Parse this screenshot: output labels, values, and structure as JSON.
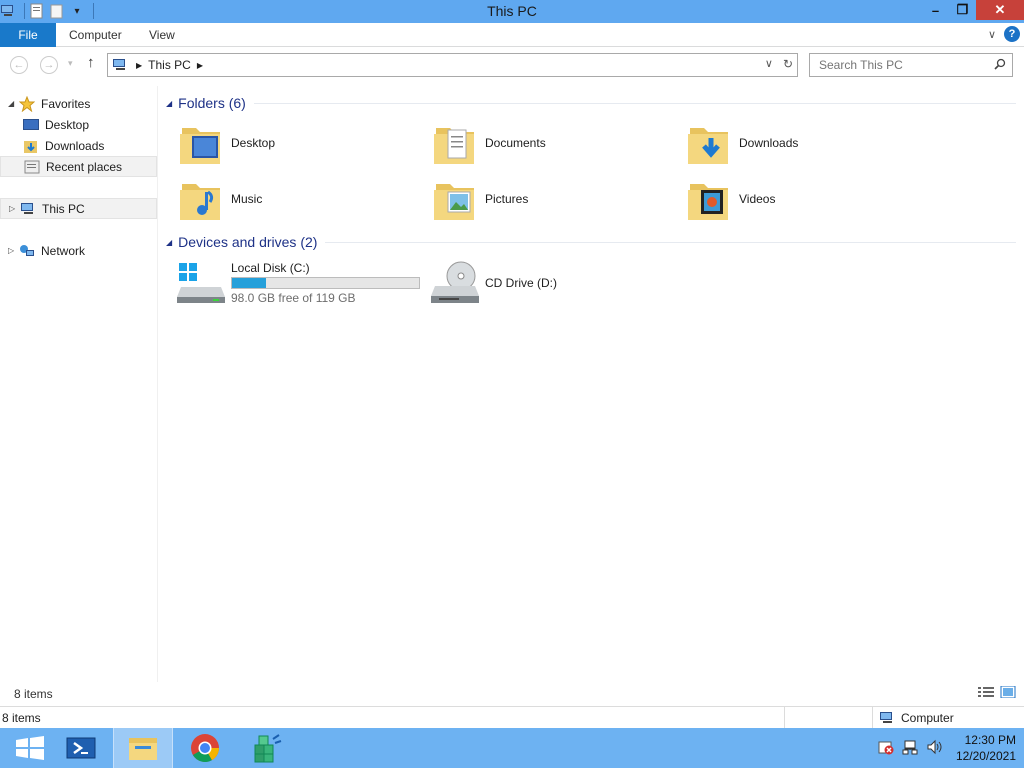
{
  "window": {
    "title": "This PC",
    "buttons": {
      "minimize": "–",
      "restore": "❐",
      "close": "✕"
    }
  },
  "ribbon": {
    "tabs": [
      "File",
      "Computer",
      "View"
    ]
  },
  "address": {
    "path": "This PC",
    "search_placeholder": "Search This PC"
  },
  "nav": {
    "favorites": "Favorites",
    "desktop": "Desktop",
    "downloads": "Downloads",
    "recent": "Recent places",
    "this_pc": "This PC",
    "network": "Network"
  },
  "folders": {
    "header": "Folders (6)",
    "items": [
      "Desktop",
      "Documents",
      "Downloads",
      "Music",
      "Pictures",
      "Videos"
    ]
  },
  "devices": {
    "header": "Devices and drives (2)",
    "local_disk": {
      "label": "Local Disk (C:)",
      "free_text": "98.0 GB free of 119 GB",
      "used_fraction": 0.18
    },
    "cd_drive": {
      "label": "CD Drive (D:)"
    }
  },
  "status": {
    "item_count": "8 items",
    "bottom_count": "8 items",
    "location": "Computer"
  },
  "taskbar": {
    "time": "12:30 PM",
    "date": "12/20/2021"
  },
  "colors": {
    "titlebar": "#5fa8f0",
    "file_tab": "#1979ca",
    "group_header": "#1e3287",
    "disk_bar": "#26a0da",
    "taskbar": "#6db2f2",
    "close": "#c7413a"
  }
}
